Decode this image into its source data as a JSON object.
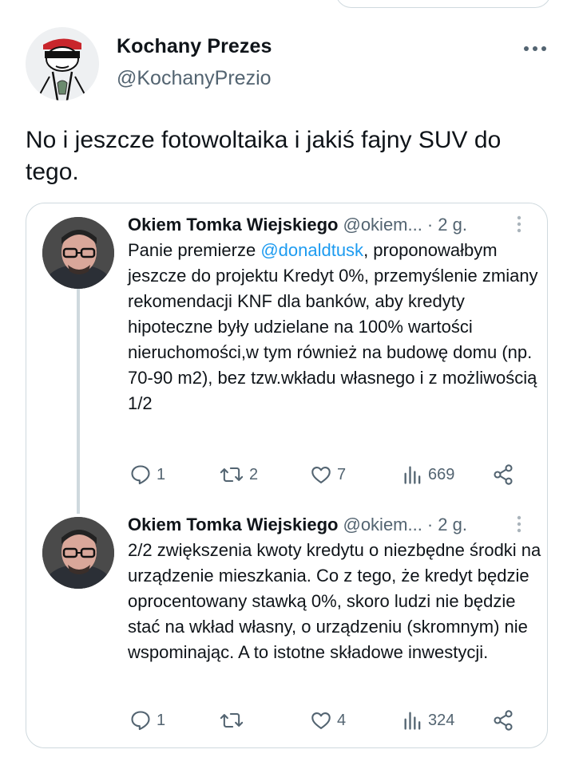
{
  "main_tweet": {
    "author": {
      "name": "Kochany Prezes",
      "handle": "@KochanyPrezio"
    },
    "text": "No i jeszcze fotowoltaika i jakiś fajny SUV do tego."
  },
  "quoted_thread": [
    {
      "author_name": "Okiem Tomka Wiejskiego",
      "author_handle": "@okiem...",
      "time": "· 2 g.",
      "text_before_mention": "Panie premierze ",
      "mention": "@donaldtusk",
      "text_after_mention": ", proponowałbym jeszcze do projektu Kredyt 0%, przemyślenie zmiany rekomendacji KNF dla banków, aby kredyty hipoteczne były udzielane na 100% wartości nieruchomości,w tym również na budowę domu (np. 70-90 m2), bez tzw.wkładu własnego i z możliwością 1/2",
      "stats": {
        "replies": "1",
        "retweets": "2",
        "likes": "7",
        "views": "669"
      }
    },
    {
      "author_name": "Okiem Tomka Wiejskiego",
      "author_handle": "@okiem...",
      "time": "· 2 g.",
      "text": "2/2 zwiększenia kwoty kredytu o niezbędne środki na urządzenie mieszkania. Co z tego, że kredyt będzie oprocentowany stawką 0%, skoro ludzi nie będzie stać na wkład własny, o urządzeniu (skromnym) nie wspominając. A to istotne składowe inwestycji.",
      "stats": {
        "replies": "1",
        "retweets": "",
        "likes": "4",
        "views": "324"
      }
    }
  ],
  "colors": {
    "text": "#0f1419",
    "secondary": "#536471",
    "accent": "#1d9bf0",
    "border": "#cfd9de"
  }
}
